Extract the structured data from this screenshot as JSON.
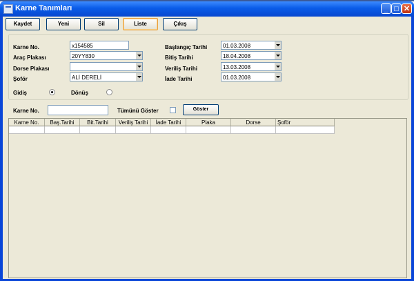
{
  "window": {
    "title": "Karne Tanımları"
  },
  "toolbar": {
    "kaydet": "Kaydet",
    "yeni": "Yeni",
    "sil": "Sil",
    "liste": "Liste",
    "cikis": "Çıkış"
  },
  "form": {
    "karne_no_label": "Karne No.",
    "karne_no_value": "x154585",
    "arac_plakasi_label": "Araç Plakası",
    "arac_plakasi_value": "20YY830",
    "dorse_plakasi_label": "Dorse Plakası",
    "dorse_plakasi_value": "",
    "sofor_label": "Şoför",
    "sofor_value": "ALİ DERELİ",
    "baslangic_label": "Başlangıç Tarihi",
    "baslangic_value": "01.03.2008",
    "bitis_label": "Bitiş Tarihi",
    "bitis_value": "18.04.2008",
    "verilis_label": "Veriliş Tarihi",
    "verilis_value": "13.03.2008",
    "iade_label": "İade Tarihi",
    "iade_value": "01.03.2008",
    "gidis_label": "Gidiş",
    "donus_label": "Dönüş",
    "direction_selected": "Gidiş"
  },
  "filter": {
    "karne_no_label": "Karne No.",
    "karne_no_value": "",
    "tumunu_goster_label": "Tümünü Göster",
    "tumunu_goster_checked": false,
    "goster_button": "Göster"
  },
  "grid": {
    "columns": [
      "Karne No.",
      "Baş.Tarihi",
      "Bit.Tarihi",
      "Veriliş Tarihi",
      "İade Tarihi",
      "Plaka",
      "Dorse",
      "Şoför"
    ],
    "rows": []
  }
}
